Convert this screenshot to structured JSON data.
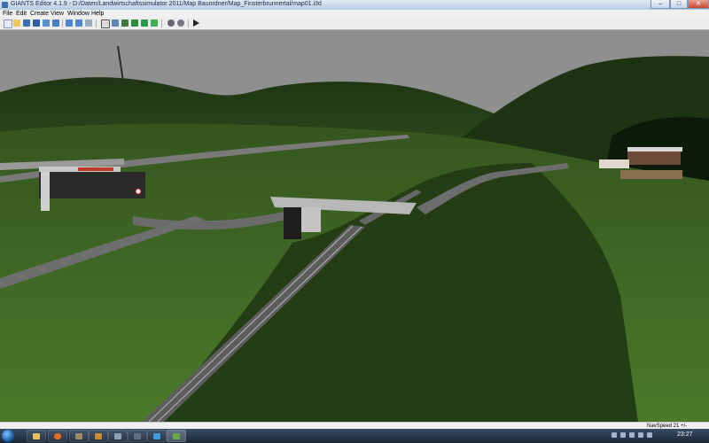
{
  "window": {
    "title": "GIANTS Editor 4.1.9 - D:/Daten/Landwirtschaftssimulator 2011/Map Bauordner/Map_Finsterbrunnertal/map01.i3d",
    "minimize_label": "–",
    "maximize_label": "□",
    "close_label": "✕"
  },
  "menu": {
    "items": [
      "File",
      "Edit",
      "Create",
      "View",
      "Window",
      "Help"
    ]
  },
  "toolbar": {
    "icons": [
      "new-icon",
      "open-icon",
      "save-icon",
      "save-as-icon",
      "import-icon",
      "export-icon",
      "undo-icon",
      "redo-icon",
      "select-icon",
      "move-icon",
      "rotate-icon",
      "scale-icon",
      "terrain-icon",
      "paint-icon",
      "foliage-icon",
      "camera-icon",
      "settings-icon",
      "play-icon"
    ]
  },
  "status": {
    "navspeed": "NavSpeed 21 +/-"
  },
  "taskbar": {
    "clock": "23:27"
  },
  "colors": {
    "sky": "#8f8f8f",
    "grass": "#3f6a24",
    "road": "#6d6d6d",
    "rail": "#7a7a7a"
  }
}
